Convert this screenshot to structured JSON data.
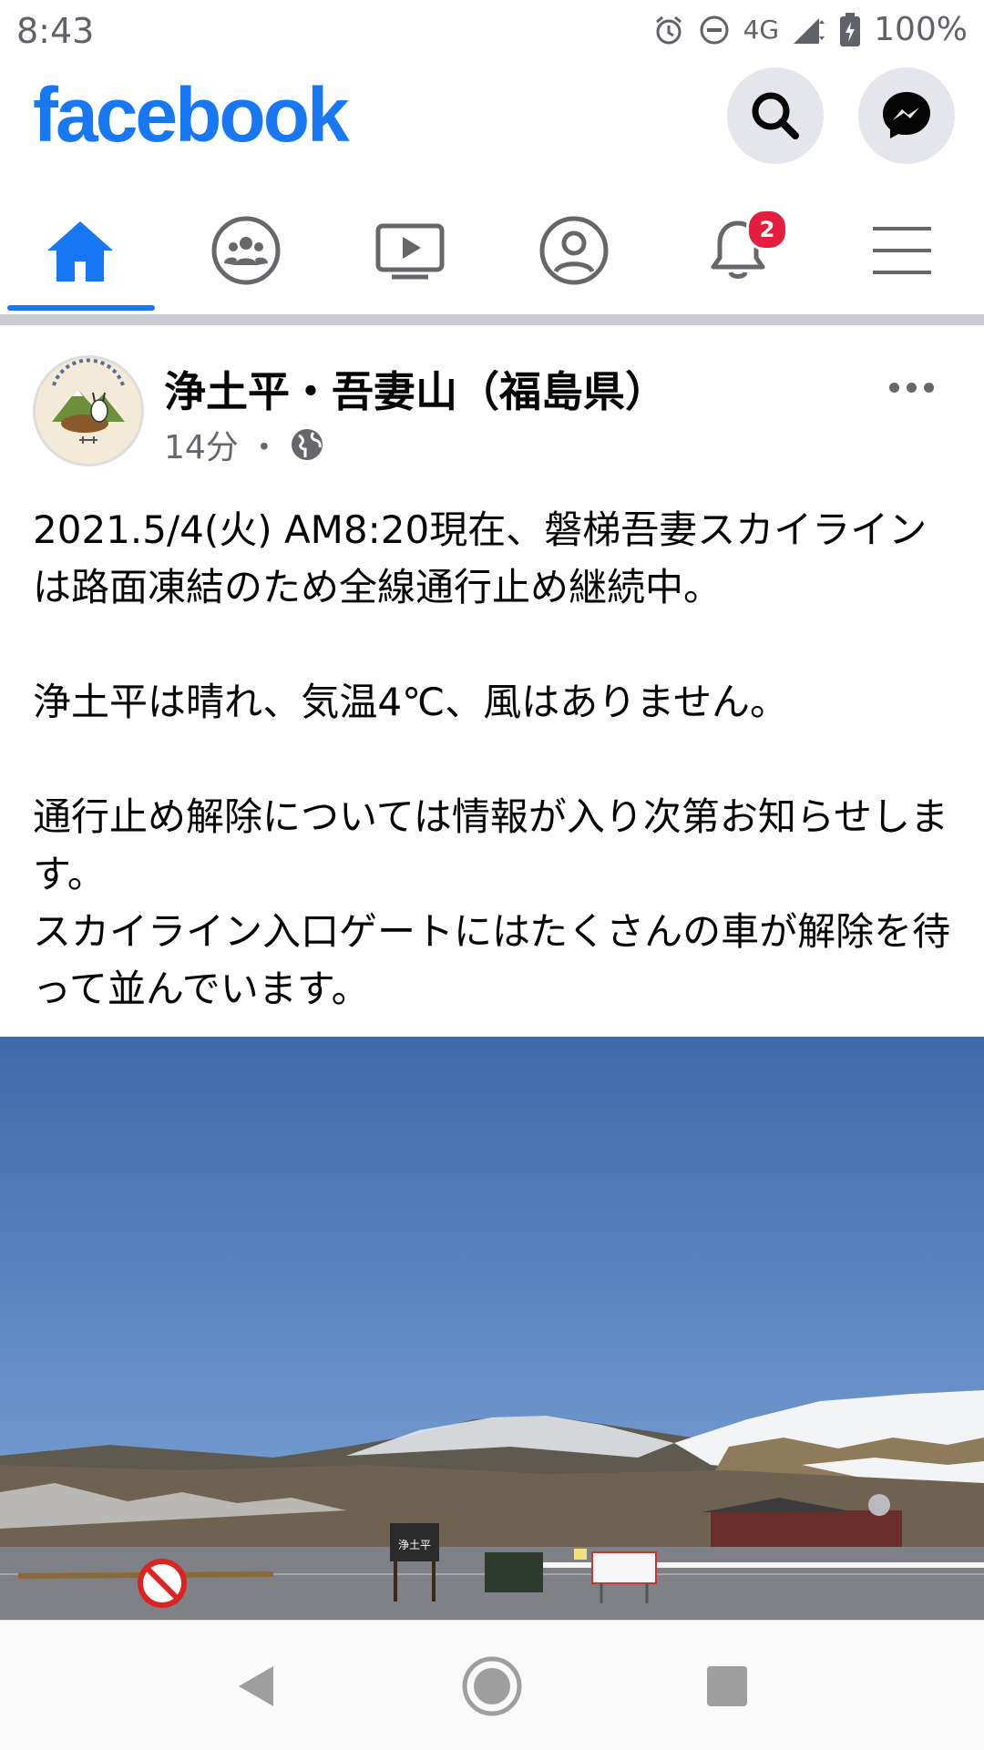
{
  "status_bar": {
    "time": "8:43",
    "network": "4G",
    "battery": "100%"
  },
  "header": {
    "logo": "facebook",
    "brand_color": "#1877f2"
  },
  "tabs": {
    "items": [
      {
        "name": "home",
        "icon": "home-icon",
        "active": true
      },
      {
        "name": "groups",
        "icon": "groups-icon"
      },
      {
        "name": "watch",
        "icon": "video-icon"
      },
      {
        "name": "profile",
        "icon": "profile-icon"
      },
      {
        "name": "notifications",
        "icon": "bell-icon",
        "badge": "2"
      },
      {
        "name": "menu",
        "icon": "hamburger-icon"
      }
    ],
    "notification_badge": "2"
  },
  "post": {
    "page_name": "浄土平・吾妻山（福島県）",
    "time": "14分",
    "separator": "・",
    "paragraphs": [
      "2021.5/4(火) AM8:20現在、磐梯吾妻スカイラインは路面凍結のため全線通行止め継続中。",
      "浄土平は晴れ、気温4℃、風はありません。",
      "通行止め解除については情報が入り次第お知らせします。",
      "スカイライン入口ゲートにはたくさんの車が解除を待って並んでいます。"
    ]
  },
  "photo": {
    "sign_label": "浄土平"
  }
}
